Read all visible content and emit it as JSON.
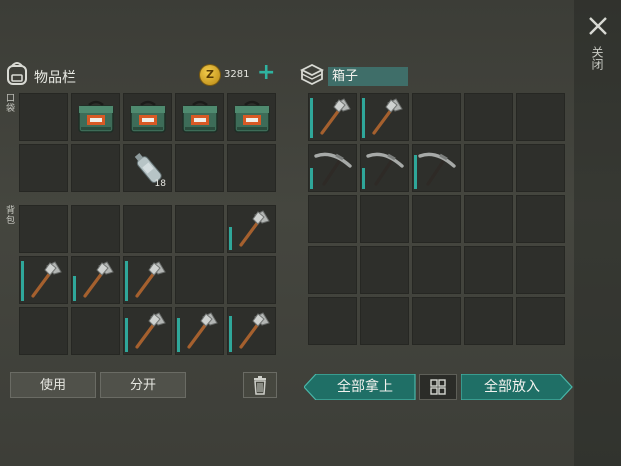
{
  "left_panel": {
    "title": "物品栏",
    "coins": "3281",
    "coin_symbol": "Z",
    "plus": "+",
    "pocket_label": "口袋",
    "backpack_label": "背包",
    "pocket_slots": [
      {
        "item": "empty"
      },
      {
        "item": "crate-icon"
      },
      {
        "item": "crate-icon"
      },
      {
        "item": "crate-icon"
      },
      {
        "item": "crate-icon"
      },
      {
        "item": "empty"
      },
      {
        "item": "empty"
      },
      {
        "item": "bottle-icon",
        "qty": "18"
      },
      {
        "item": "empty"
      },
      {
        "item": "empty"
      }
    ],
    "backpack_slots": [
      {
        "item": "empty"
      },
      {
        "item": "empty"
      },
      {
        "item": "empty"
      },
      {
        "item": "empty"
      },
      {
        "item": "hatchet-icon",
        "durability": 0.55
      },
      {
        "item": "hatchet-icon",
        "durability": 0.95
      },
      {
        "item": "hatchet-icon",
        "durability": 0.6
      },
      {
        "item": "hatchet-icon",
        "durability": 0.95
      },
      {
        "item": "empty"
      },
      {
        "item": "empty"
      },
      {
        "item": "empty"
      },
      {
        "item": "empty"
      },
      {
        "item": "hatchet-icon",
        "durability": 0.8
      },
      {
        "item": "hatchet-icon",
        "durability": 0.8
      },
      {
        "item": "hatchet-icon",
        "durability": 0.85
      }
    ],
    "use_button": "使用",
    "split_button": "分开"
  },
  "right_panel": {
    "title": "箱子",
    "slots": [
      {
        "item": "hatchet-icon",
        "durability": 0.95
      },
      {
        "item": "hatchet-icon",
        "durability": 0.95
      },
      {
        "item": "empty"
      },
      {
        "item": "empty"
      },
      {
        "item": "empty"
      },
      {
        "item": "pickaxe-icon",
        "durability": 0.5
      },
      {
        "item": "pickaxe-icon",
        "durability": 0.5
      },
      {
        "item": "pickaxe-icon",
        "durability": 0.8
      },
      {
        "item": "empty"
      },
      {
        "item": "empty"
      },
      {
        "item": "empty"
      },
      {
        "item": "empty"
      },
      {
        "item": "empty"
      },
      {
        "item": "empty"
      },
      {
        "item": "empty"
      },
      {
        "item": "empty"
      },
      {
        "item": "empty"
      },
      {
        "item": "empty"
      },
      {
        "item": "empty"
      },
      {
        "item": "empty"
      },
      {
        "item": "empty"
      },
      {
        "item": "empty"
      },
      {
        "item": "empty"
      },
      {
        "item": "empty"
      },
      {
        "item": "empty"
      }
    ],
    "take_all_button": "全部拿上",
    "put_all_button": "全部放入"
  },
  "close_label": "关闭",
  "colors": {
    "accent": "#2fa79a",
    "button_teal": "#1f6f66",
    "coin": "#e2b02c"
  }
}
